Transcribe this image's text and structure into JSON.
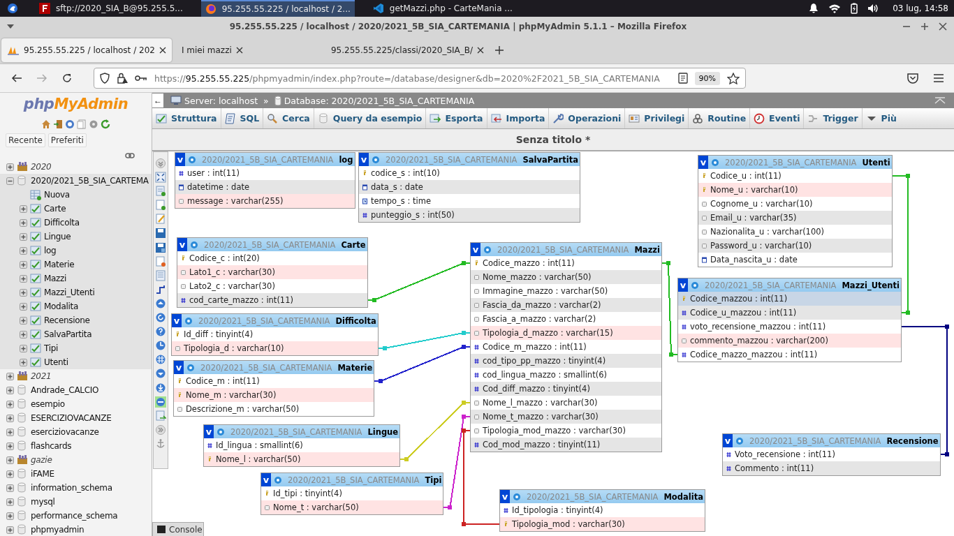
{
  "taskbar": {
    "tasks": [
      {
        "label": "sftp://2020_SIA_B@95.255.5...",
        "kind": "ftp",
        "selected": false
      },
      {
        "label": "95.255.55.225 / localhost / 2...",
        "kind": "browser",
        "selected": true
      },
      {
        "label": "getMazzi.php - CarteMania ...",
        "kind": "editor",
        "selected": false
      }
    ],
    "clock": "03 lug, 14:58"
  },
  "window": {
    "title": "95.255.55.225 / localhost / 2020/2021_5B_SIA_CARTEMANIA | phpMyAdmin 5.1.1 – Mozilla Firefox"
  },
  "browser_tabs": [
    {
      "label": "95.255.55.225 / localhost / 202",
      "selected": true
    },
    {
      "label": "I miei mazzi",
      "selected": false
    },
    {
      "label": "95.255.55.225/classi/2020_SIA_B/",
      "selected": false
    }
  ],
  "address_bar": {
    "scheme": "https://",
    "host": "95.255.55.225",
    "path": "/phpmyadmin/index.php?route=/database/designer&db=2020%2F2021_5B_SIA_CARTEMANIA",
    "zoom": "90%"
  },
  "sidebar": {
    "logo": {
      "first": "php",
      "second": "MyAdmin"
    },
    "buttons": [
      "Recente",
      "Preferiti"
    ],
    "tree": [
      {
        "label": "2020",
        "kind": "group",
        "expanded": false,
        "selected": false
      },
      {
        "label": "2020/2021_5B_SIA_CARTEMA",
        "kind": "database",
        "expanded": true,
        "selected": true,
        "children": [
          {
            "label": "Nuova",
            "kind": "new"
          },
          {
            "label": "Carte",
            "kind": "table"
          },
          {
            "label": "Difficolta",
            "kind": "table"
          },
          {
            "label": "Lingue",
            "kind": "table"
          },
          {
            "label": "log",
            "kind": "table"
          },
          {
            "label": "Materie",
            "kind": "table"
          },
          {
            "label": "Mazzi",
            "kind": "table"
          },
          {
            "label": "Mazzi_Utenti",
            "kind": "table"
          },
          {
            "label": "Modalita",
            "kind": "table"
          },
          {
            "label": "Recensione",
            "kind": "table"
          },
          {
            "label": "SalvaPartita",
            "kind": "table"
          },
          {
            "label": "Tipi",
            "kind": "table"
          },
          {
            "label": "Utenti",
            "kind": "table"
          }
        ]
      },
      {
        "label": "2021",
        "kind": "group",
        "expanded": false,
        "selected": false
      },
      {
        "label": "Andrade_CALCIO",
        "kind": "database",
        "expanded": false,
        "selected": false
      },
      {
        "label": "esempio",
        "kind": "database",
        "expanded": false,
        "selected": false
      },
      {
        "label": "ESERCIZIOVACANZE",
        "kind": "database",
        "expanded": false,
        "selected": false
      },
      {
        "label": "eserciziovacanze",
        "kind": "database",
        "expanded": false,
        "selected": false
      },
      {
        "label": "flashcards",
        "kind": "database",
        "expanded": false,
        "selected": false
      },
      {
        "label": "gazie",
        "kind": "group",
        "expanded": false,
        "selected": false
      },
      {
        "label": "iFAME",
        "kind": "database",
        "expanded": false,
        "selected": false
      },
      {
        "label": "information_schema",
        "kind": "database",
        "expanded": false,
        "selected": false
      },
      {
        "label": "mysql",
        "kind": "database",
        "expanded": false,
        "selected": false
      },
      {
        "label": "performance_schema",
        "kind": "database",
        "expanded": false,
        "selected": false
      },
      {
        "label": "phpmyadmin",
        "kind": "database",
        "expanded": false,
        "selected": false
      }
    ]
  },
  "breadcrumb": {
    "collapse": "←",
    "server": "Server: localhost",
    "separator": "»",
    "database": "Database: 2020/2021_5B_SIA_CARTEMANIA"
  },
  "menu": [
    {
      "label": "Struttura",
      "kind": "structure"
    },
    {
      "label": "SQL",
      "kind": "sql"
    },
    {
      "label": "Cerca",
      "kind": "search"
    },
    {
      "label": "Query da esempio",
      "kind": "query"
    },
    {
      "label": "Esporta",
      "kind": "export"
    },
    {
      "label": "Importa",
      "kind": "import"
    },
    {
      "label": "Operazioni",
      "kind": "operations"
    },
    {
      "label": "Privilegi",
      "kind": "privileges"
    },
    {
      "label": "Routine",
      "kind": "routines"
    },
    {
      "label": "Eventi",
      "kind": "events"
    },
    {
      "label": "Trigger",
      "kind": "triggers"
    },
    {
      "label": "Più",
      "kind": "more"
    }
  ],
  "designer": {
    "title": "Senza titolo *",
    "tables": [
      {
        "toggle": "v",
        "schema": "2020/2021_5B_SIA_CARTEMANIA",
        "name": "log",
        "fields": [
          {
            "label": "user : int(11)",
            "kind": "number",
            "highlighted": false,
            "selected": false
          },
          {
            "label": "datetime : date",
            "kind": "date",
            "highlighted": false,
            "selected": false
          },
          {
            "label": "message : varchar(255)",
            "kind": "text",
            "highlighted": true,
            "selected": false
          }
        ]
      },
      {
        "toggle": "v",
        "schema": "2020/2021_5B_SIA_CARTEMANIA",
        "name": "SalvaPartita",
        "fields": [
          {
            "label": "codice_s : int(10)",
            "kind": "key",
            "highlighted": false,
            "selected": false
          },
          {
            "label": "data_s : date",
            "kind": "date",
            "highlighted": false,
            "selected": false
          },
          {
            "label": "tempo_s : time",
            "kind": "time",
            "highlighted": false,
            "selected": false
          },
          {
            "label": "punteggio_s : int(50)",
            "kind": "number",
            "highlighted": false,
            "selected": false
          }
        ]
      },
      {
        "toggle": "v",
        "schema": "2020/2021_5B_SIA_CARTEMANIA",
        "name": "Carte",
        "fields": [
          {
            "label": "Codice_c : int(20)",
            "kind": "key",
            "highlighted": false,
            "selected": false
          },
          {
            "label": "Lato1_c : varchar(30)",
            "kind": "text",
            "highlighted": true,
            "selected": false
          },
          {
            "label": "Lato2_c : varchar(30)",
            "kind": "text",
            "highlighted": false,
            "selected": false
          },
          {
            "label": "cod_carte_mazzo : int(11)",
            "kind": "number",
            "highlighted": false,
            "selected": false
          }
        ]
      },
      {
        "toggle": "v",
        "schema": "2020/2021_5B_SIA_CARTEMANIA",
        "name": "Difficolta",
        "fields": [
          {
            "label": "Id_diff : tinyint(4)",
            "kind": "key",
            "highlighted": false,
            "selected": false
          },
          {
            "label": "Tipologia_d : varchar(10)",
            "kind": "text",
            "highlighted": true,
            "selected": false
          }
        ]
      },
      {
        "toggle": "v",
        "schema": "2020/2021_5B_SIA_CARTEMANIA",
        "name": "Materie",
        "fields": [
          {
            "label": "Codice_m : int(11)",
            "kind": "key",
            "highlighted": false,
            "selected": false
          },
          {
            "label": "Nome_m : varchar(30)",
            "kind": "key",
            "highlighted": true,
            "selected": false
          },
          {
            "label": "Descrizione_m : varchar(50)",
            "kind": "text",
            "highlighted": false,
            "selected": false
          }
        ]
      },
      {
        "toggle": "v",
        "schema": "2020/2021_5B_SIA_CARTEMANIA",
        "name": "Lingue",
        "fields": [
          {
            "label": "Id_lingua : smallint(6)",
            "kind": "number",
            "highlighted": false,
            "selected": false
          },
          {
            "label": "Nome_l : varchar(50)",
            "kind": "key",
            "highlighted": true,
            "selected": false
          }
        ]
      },
      {
        "toggle": "v",
        "schema": "2020/2021_5B_SIA_CARTEMANIA",
        "name": "Tipi",
        "fields": [
          {
            "label": "Id_tipi : tinyint(4)",
            "kind": "key",
            "highlighted": false,
            "selected": false
          },
          {
            "label": "Nome_t : varchar(50)",
            "kind": "text",
            "highlighted": true,
            "selected": false
          }
        ]
      },
      {
        "toggle": "v",
        "schema": "2020/2021_5B_SIA_CARTEMANIA",
        "name": "Mazzi",
        "fields": [
          {
            "label": "Codice_mazzo : int(11)",
            "kind": "key",
            "highlighted": false,
            "selected": false
          },
          {
            "label": "Nome_mazzo : varchar(50)",
            "kind": "text",
            "highlighted": false,
            "selected": false
          },
          {
            "label": "Immagine_mazzo : varchar(50)",
            "kind": "text",
            "highlighted": false,
            "selected": false
          },
          {
            "label": "Fascia_da_mazzo : varchar(2)",
            "kind": "text",
            "highlighted": false,
            "selected": false
          },
          {
            "label": "Fascia_a_mazzo : varchar(2)",
            "kind": "text",
            "highlighted": false,
            "selected": false
          },
          {
            "label": "Tipologia_d_mazzo : varchar(15)",
            "kind": "text",
            "highlighted": true,
            "selected": false
          },
          {
            "label": "Codice_m_mazzo : int(11)",
            "kind": "number",
            "highlighted": false,
            "selected": false
          },
          {
            "label": "cod_tipo_pp_mazzo : tinyint(4)",
            "kind": "number",
            "highlighted": false,
            "selected": false
          },
          {
            "label": "cod_lingua_mazzo : smallint(6)",
            "kind": "number",
            "highlighted": false,
            "selected": false
          },
          {
            "label": "Cod_diff_mazzo : tinyint(4)",
            "kind": "number",
            "highlighted": false,
            "selected": false
          },
          {
            "label": "Nome_l_mazzo : varchar(30)",
            "kind": "text",
            "highlighted": false,
            "selected": false
          },
          {
            "label": "Nome_t_mazzo : varchar(30)",
            "kind": "text",
            "highlighted": false,
            "selected": false
          },
          {
            "label": "Tipologia_mod_mazzo : varchar(30)",
            "kind": "text",
            "highlighted": false,
            "selected": false
          },
          {
            "label": "Cod_mod_mazzo : tinyint(11)",
            "kind": "number",
            "highlighted": false,
            "selected": false
          }
        ]
      },
      {
        "toggle": "v",
        "schema": "2020/2021_5B_SIA_CARTEMANIA",
        "name": "Modalita",
        "fields": [
          {
            "label": "Id_tipologia : tinyint(4)",
            "kind": "number",
            "highlighted": false,
            "selected": false
          },
          {
            "label": "Tipologia_mod : varchar(30)",
            "kind": "key",
            "highlighted": true,
            "selected": false
          }
        ]
      },
      {
        "toggle": "v",
        "schema": "2020/2021_5B_SIA_CARTEMANIA",
        "name": "Utenti",
        "fields": [
          {
            "label": "Codice_u : int(11)",
            "kind": "key",
            "highlighted": false,
            "selected": false
          },
          {
            "label": "Nome_u : varchar(10)",
            "kind": "key",
            "highlighted": true,
            "selected": false
          },
          {
            "label": "Cognome_u : varchar(10)",
            "kind": "text",
            "highlighted": false,
            "selected": false
          },
          {
            "label": "Email_u : varchar(35)",
            "kind": "text",
            "highlighted": false,
            "selected": false
          },
          {
            "label": "Nazionalita_u : varchar(100)",
            "kind": "text",
            "highlighted": false,
            "selected": false
          },
          {
            "label": "Password_u : varchar(10)",
            "kind": "text",
            "highlighted": false,
            "selected": false
          },
          {
            "label": "Data_nascita_u : date",
            "kind": "date",
            "highlighted": false,
            "selected": false
          }
        ]
      },
      {
        "toggle": "v",
        "schema": "2020/2021_5B_SIA_CARTEMANIA",
        "name": "Mazzi_Utenti",
        "fields": [
          {
            "label": "Codice_mazzou : int(11)",
            "kind": "key",
            "highlighted": false,
            "selected": true
          },
          {
            "label": "Codice_u_mazzou : int(11)",
            "kind": "number",
            "highlighted": false,
            "selected": false
          },
          {
            "label": "voto_recensione_mazzou : int(11)",
            "kind": "number",
            "highlighted": false,
            "selected": false
          },
          {
            "label": "commento_mazzou : varchar(200)",
            "kind": "text",
            "highlighted": true,
            "selected": false
          },
          {
            "label": "Codice_mazzo_mazzou : int(11)",
            "kind": "number",
            "highlighted": false,
            "selected": false
          }
        ]
      },
      {
        "toggle": "v",
        "schema": "2020/2021_5B_SIA_CARTEMANIA",
        "name": "Recensione",
        "fields": [
          {
            "label": "Voto_recensione : int(11)",
            "kind": "number",
            "highlighted": false,
            "selected": false
          },
          {
            "label": "Commento : int(11)",
            "kind": "number",
            "highlighted": false,
            "selected": false
          }
        ]
      }
    ],
    "relations": [
      {
        "color": "#22bb22"
      },
      {
        "color": "#22cccc"
      },
      {
        "color": "#2222cc"
      },
      {
        "color": "#cccc22"
      },
      {
        "color": "#cc22cc"
      },
      {
        "color": "#cc2222"
      },
      {
        "color": "#22bb22"
      },
      {
        "color": "#22bb22"
      },
      {
        "color": "#000080"
      }
    ]
  },
  "console": {
    "label": "Console"
  }
}
